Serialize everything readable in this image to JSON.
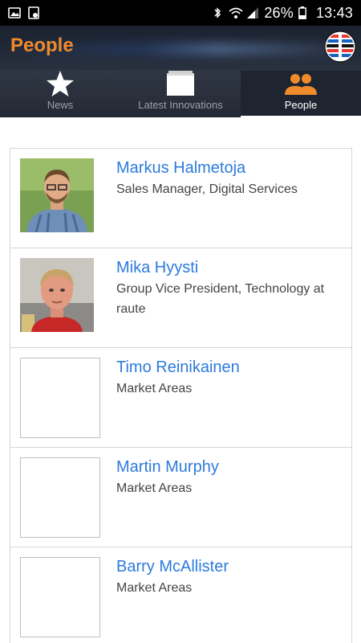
{
  "status_bar": {
    "battery": "26%",
    "time": "13:43"
  },
  "header": {
    "title": "People",
    "accent_color": "#f08b2c"
  },
  "tabs": [
    {
      "label": "News",
      "icon": "star-icon",
      "active": false
    },
    {
      "label": "Latest Innovations",
      "icon": "folder-icon",
      "active": false
    },
    {
      "label": "People",
      "icon": "people-icon",
      "active": true
    }
  ],
  "people": [
    {
      "name": "Markus Halmetoja",
      "role": "Sales Manager, Digital Services",
      "has_photo": true
    },
    {
      "name": "Mika Hyysti",
      "role": "Group Vice President, Technology at raute",
      "has_photo": true
    },
    {
      "name": "Timo Reinikainen",
      "role": "Market Areas",
      "has_photo": false
    },
    {
      "name": "Martin Murphy",
      "role": "Market Areas",
      "has_photo": false
    },
    {
      "name": "Barry McAllister",
      "role": "Market Areas",
      "has_photo": false
    }
  ]
}
